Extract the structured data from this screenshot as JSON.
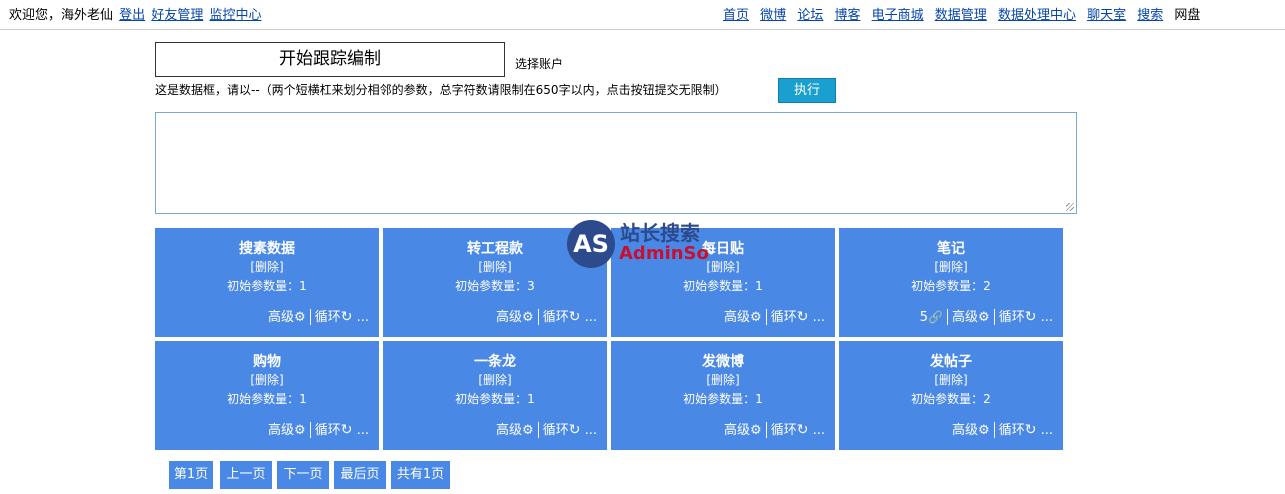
{
  "topbar": {
    "welcome": "欢迎您，海外老仙",
    "links": [
      "登出",
      "好友管理",
      "监控中心"
    ],
    "nav": [
      "首页",
      "微博",
      "论坛",
      "博客",
      "电子商城",
      "数据管理",
      "数据处理中心",
      "聊天室",
      "搜索"
    ],
    "nav_plain": "网盘"
  },
  "form": {
    "title": "开始跟踪编制",
    "account_label": "选择账户",
    "hint": "这是数据框，请以--（两个短横杠来划分相邻的参数，总字符数请限制在650字以内，点击按钮提交无限制）",
    "execute": "执行"
  },
  "cards": [
    {
      "title": "搜素数据",
      "delete": "[删除]",
      "params": "初始参数量：1",
      "link_count": "",
      "advanced": "高级",
      "loop": "循环",
      "more": "..."
    },
    {
      "title": "转工程款",
      "delete": "[删除]",
      "params": "初始参数量：3",
      "link_count": "",
      "advanced": "高级",
      "loop": "循环",
      "more": "..."
    },
    {
      "title": "每日贴",
      "delete": "[删除]",
      "params": "初始参数量：1",
      "link_count": "",
      "advanced": "高级",
      "loop": "循环",
      "more": "..."
    },
    {
      "title": "笔记",
      "delete": "[删除]",
      "params": "初始参数量：2",
      "link_count": "5",
      "advanced": "高级",
      "loop": "循环",
      "more": "..."
    },
    {
      "title": "购物",
      "delete": "[删除]",
      "params": "初始参数量：1",
      "link_count": "",
      "advanced": "高级",
      "loop": "循环",
      "more": "..."
    },
    {
      "title": "一条龙",
      "delete": "[删除]",
      "params": "初始参数量：1",
      "link_count": "",
      "advanced": "高级",
      "loop": "循环",
      "more": "..."
    },
    {
      "title": "发微博",
      "delete": "[删除]",
      "params": "初始参数量：1",
      "link_count": "",
      "advanced": "高级",
      "loop": "循环",
      "more": "..."
    },
    {
      "title": "发帖子",
      "delete": "[删除]",
      "params": "初始参数量：2",
      "link_count": "",
      "advanced": "高级",
      "loop": "循环",
      "more": "..."
    }
  ],
  "pager": [
    "第1页",
    "上一页",
    "下一页",
    "最后页",
    "共有1页"
  ],
  "watermark": {
    "badge": "AS",
    "cn": "站长搜索",
    "en": "AdminSo"
  },
  "icons": {
    "advanced": "gear-icon",
    "loop": "refresh-icon",
    "link": "link-icon"
  },
  "colors": {
    "card": "#4a88e6",
    "execute": "#1aa0cf",
    "link": "#0645ad"
  }
}
